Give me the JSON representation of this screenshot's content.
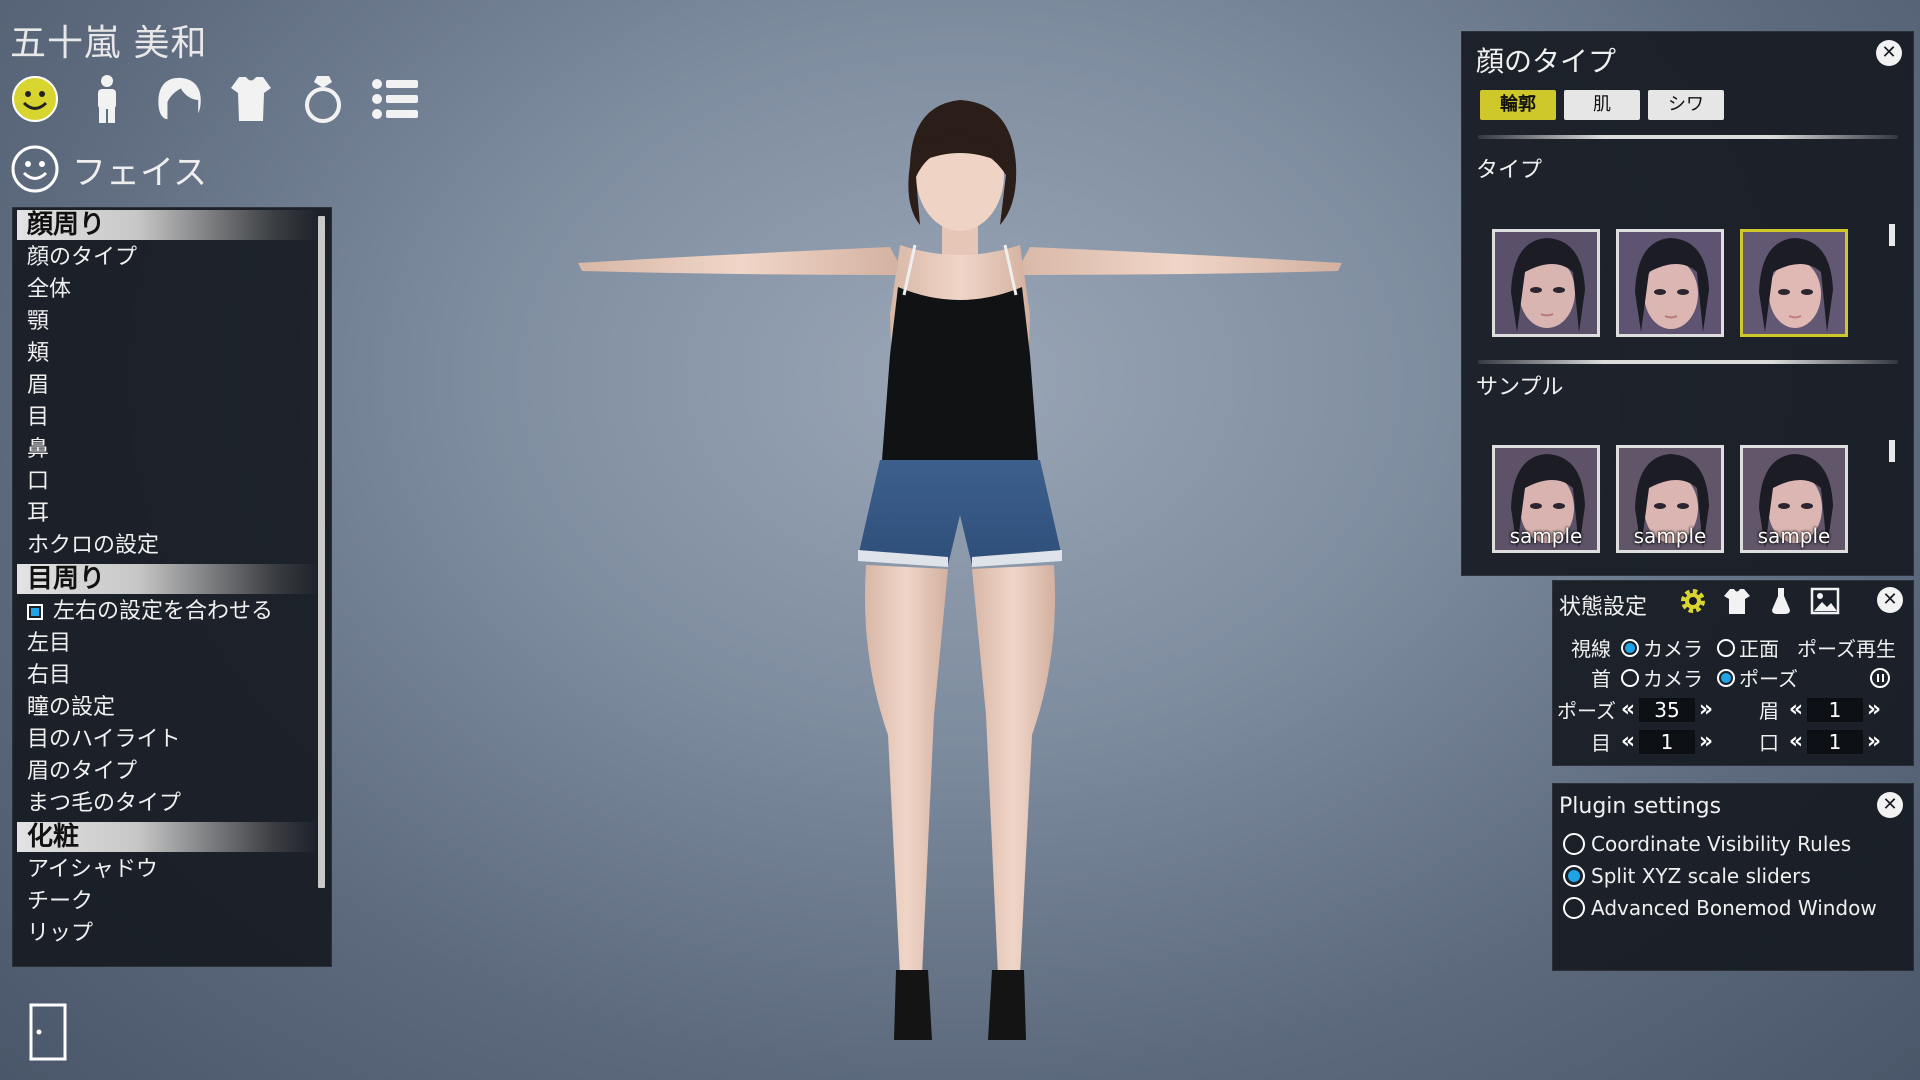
{
  "character": {
    "name": "五十嵐 美和"
  },
  "category_icons": [
    "face-icon",
    "body-icon",
    "hair-icon",
    "clothes-icon",
    "accessory-icon",
    "list-icon"
  ],
  "section": {
    "title": "フェイス",
    "icon": "face-icon"
  },
  "left_menu": {
    "groups": [
      {
        "header": "顔周り",
        "items": [
          "顔のタイプ",
          "全体",
          "顎",
          "頬",
          "眉",
          "目",
          "鼻",
          "口",
          "耳",
          "ホクロの設定"
        ]
      },
      {
        "header": "目周り",
        "checkbox": {
          "label": "左右の設定を合わせる",
          "checked": true
        },
        "items": [
          "左目",
          "右目",
          "瞳の設定",
          "目のハイライト",
          "眉のタイプ",
          "まつ毛のタイプ"
        ]
      },
      {
        "header": "化粧",
        "items": [
          "アイシャドウ",
          "チーク",
          "リップ"
        ]
      }
    ]
  },
  "face_panel": {
    "title": "顔のタイプ",
    "tabs": [
      "輪郭",
      "肌",
      "シワ"
    ],
    "active_tab": "輪郭",
    "type_label": "タイプ",
    "sample_label": "サンプル",
    "sample_thumb_label": "sample",
    "selected_type_index": 2
  },
  "state_panel": {
    "title": "状態設定",
    "icons": [
      "gear-icon",
      "outfit-icon",
      "light-icon",
      "background-icon"
    ],
    "gaze_label": "視線",
    "gaze_options": [
      "カメラ",
      "正面"
    ],
    "gaze_selected": "カメラ",
    "neck_label": "首",
    "neck_options": [
      "カメラ",
      "ポーズ"
    ],
    "neck_selected": "ポーズ",
    "pose_play_label": "ポーズ再生",
    "pose_label": "ポーズ",
    "pose_value": "35",
    "brow_label": "眉",
    "brow_value": "1",
    "eye_label": "目",
    "eye_value": "1",
    "mouth_label": "口",
    "mouth_value": "1"
  },
  "plugin_panel": {
    "title": "Plugin settings",
    "options": [
      {
        "label": "Coordinate Visibility Rules",
        "checked": false
      },
      {
        "label": "Split XYZ scale sliders",
        "checked": true
      },
      {
        "label": "Advanced Bonemod Window",
        "checked": false
      }
    ]
  },
  "colors": {
    "accent_yellow": "#cfc82a",
    "accent_blue": "#1fa4e8",
    "panel_bg": "#161a22"
  }
}
